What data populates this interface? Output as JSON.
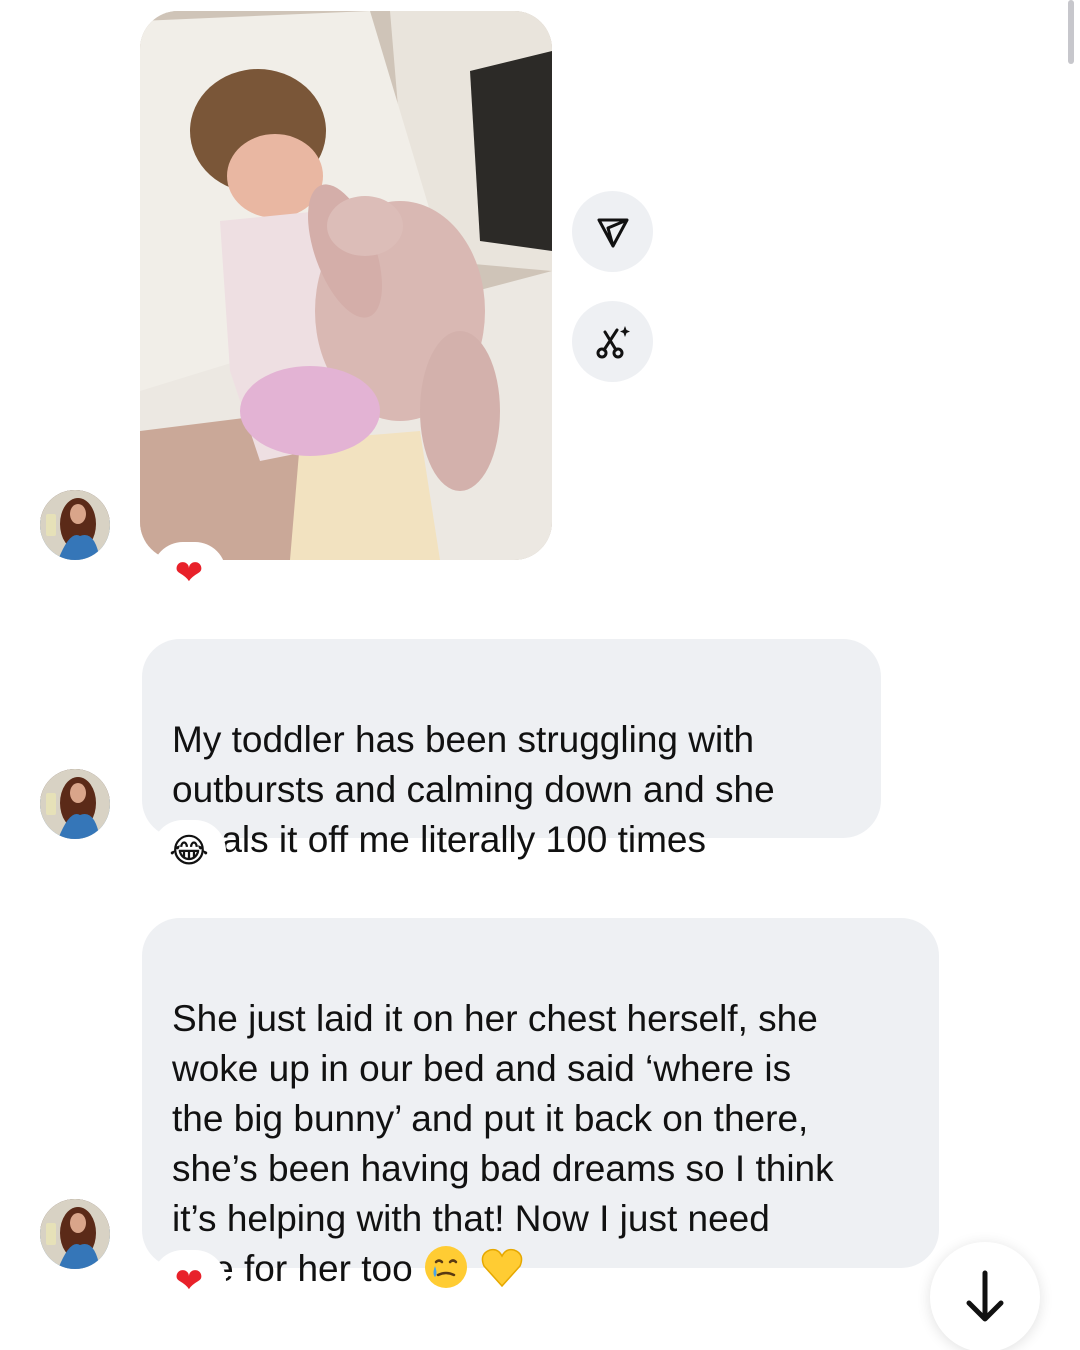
{
  "conversation": {
    "messages": [
      {
        "kind": "photo",
        "reaction": "❤"
      },
      {
        "kind": "text",
        "text": "My toddler has been struggling with\noutbursts and calming down and she\nsteals it off me literally 100 times",
        "reaction": "😂"
      },
      {
        "kind": "text",
        "text": "She just laid it on her chest herself, she\nwoke up in our bed and said ‘where is\nthe big bunny’ and put it back on there,\nshe’s been having bad dreams so I think\nit’s helping with that! Now I just need\none for her too",
        "trailing_emojis": [
          "🥲",
          "💛"
        ],
        "reaction": "❤"
      }
    ]
  },
  "actions": {
    "share_icon": "share-icon",
    "ai_edit_icon": "magic-scissors-icon",
    "scroll_down_icon": "arrow-down-icon"
  },
  "colors": {
    "bubble": "#eef0f3",
    "heart": "#e8212a",
    "emoji_yellow": "#ffcc33"
  }
}
